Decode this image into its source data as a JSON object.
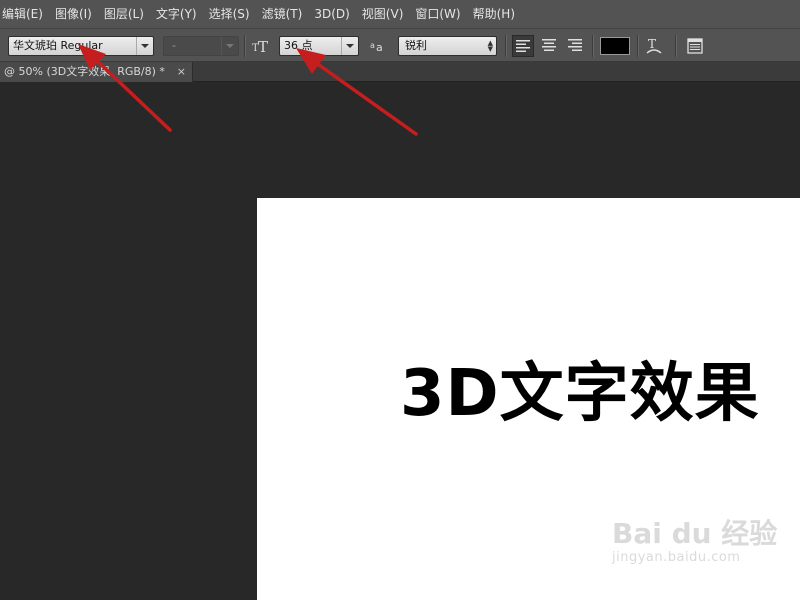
{
  "menubar": {
    "items": [
      "编辑(E)",
      "图像(I)",
      "图层(L)",
      "文字(Y)",
      "选择(S)",
      "滤镜(T)",
      "3D(D)",
      "视图(V)",
      "窗口(W)",
      "帮助(H)"
    ]
  },
  "options": {
    "font_family": "华文琥珀 Regular",
    "font_style": "-",
    "font_size": "36 点",
    "anti_alias": "锐利",
    "text_color": "#000000"
  },
  "document": {
    "tab_title": "@ 50% (3D文字效果, RGB/8) *",
    "close_glyph": "×"
  },
  "canvas": {
    "text": "3D文字效果"
  },
  "watermark": {
    "logo": "Bai du 经验",
    "url": "jingyan.baidu.com"
  },
  "icons": [
    "font-size-icon",
    "anti-alias-icon",
    "align-left-icon",
    "align-center-icon",
    "align-right-icon",
    "warp-text-icon",
    "character-panel-icon"
  ],
  "colors": {
    "annotation_arrow": "#c41e1e",
    "panel_bg": "#535353",
    "workspace_bg": "#282828"
  }
}
